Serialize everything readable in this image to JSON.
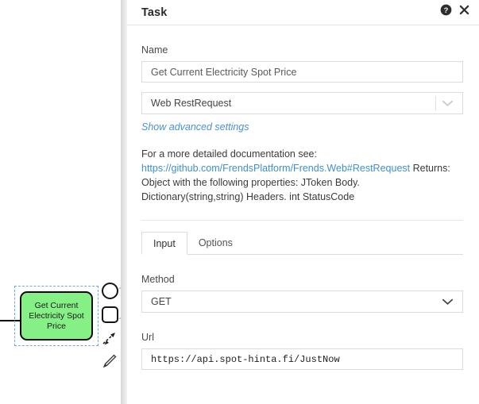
{
  "canvas": {
    "node": {
      "label": "Get Current Electricity Spot Price",
      "fill_color": "#85f085",
      "border_color": "#0a0a0a",
      "selected": true,
      "selection_color": "#6fa8e8"
    },
    "context_pad": [
      {
        "name": "append-end-event",
        "icon": "circle-icon"
      },
      {
        "name": "append-task",
        "icon": "rounded-square-icon"
      },
      {
        "name": "append-connection",
        "icon": "dashed-arrow-icon"
      },
      {
        "name": "connect-tool",
        "icon": "pencil-icon"
      }
    ],
    "incoming_flow": "sequence-flow-arrow"
  },
  "panel": {
    "title": "Task",
    "help_icon": "help-circle-icon",
    "close_icon": "close-icon",
    "name": {
      "label": "Name",
      "value": "Get Current Electricity Spot Price",
      "placeholder": "Name"
    },
    "task_type": {
      "value": "Web RestRequest",
      "chevron_icon": "chevron-down-icon"
    },
    "advanced_link": "Show advanced settings",
    "documentation": {
      "intro": "For a more detailed documentation see:",
      "link": "https://github.com/FrendsPlatform/Frends.Web#RestRequest",
      "after_link": " Returns:",
      "line3": "Object with the following properties: JToken Body.",
      "line4": "Dictionary(string,string) Headers. int StatusCode"
    },
    "tabs": [
      {
        "label": "Input",
        "active": true
      },
      {
        "label": "Options",
        "active": false
      }
    ],
    "method": {
      "label": "Method",
      "value": "GET",
      "chevron_icon": "chevron-down-icon"
    },
    "url": {
      "label": "Url",
      "value": "https://api.spot-hinta.fi/JustNow",
      "placeholder": "Url"
    }
  },
  "colors": {
    "link": "#3f8fd4",
    "italic_link": "#4a90d9",
    "border": "#dcdcdc",
    "node_green": "#85f085"
  }
}
